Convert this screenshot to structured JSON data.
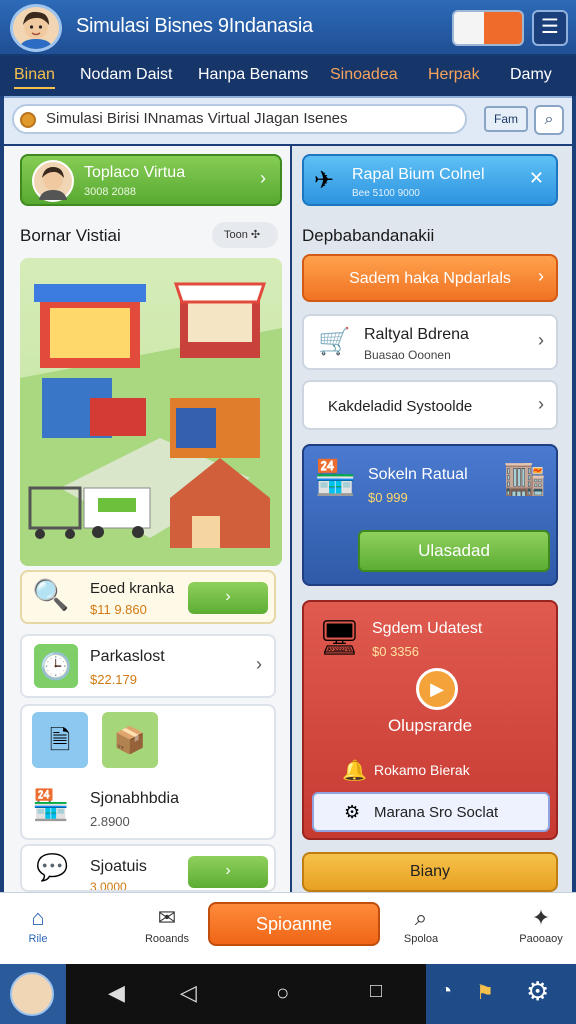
{
  "header": {
    "title": "Simulasi Bisnes 9Indanasia"
  },
  "nav": {
    "tabs": [
      "Binan",
      "Nodam Daist",
      "Hanpa Benams",
      "Sinoadea",
      "Herpak",
      "Damy"
    ]
  },
  "search": {
    "value": "Simulasi Birisi INnamas Virtual JIagan Isenes",
    "chip": "Fam"
  },
  "left": {
    "top_button": {
      "title": "Toplaco Virtua",
      "sub": "3008 2088"
    },
    "section_title": "Bornar Vistiai",
    "section_chip": "Toon",
    "list": [
      {
        "title": "Eoed kranka",
        "value": "$11 9.860"
      },
      {
        "title": "Parkaslost",
        "value": "$22.179"
      },
      {
        "title": "Sjonabhbdia",
        "value": "2.8900"
      },
      {
        "title": "Sjoatuis",
        "value": "3.0000"
      }
    ]
  },
  "right": {
    "top_button": {
      "title": "Rapal Bium Colnel",
      "sub": "Bee 5100 9000"
    },
    "section_title": "Depbabandanakii",
    "orange_button": "Sadem haka Npdarlals",
    "item1": {
      "title": "Raltyal Bdrena",
      "sub": "Buasao Ooonen"
    },
    "item2": {
      "title": "Kakdeladid Systoolde"
    },
    "blue_card": {
      "title": "Sokeln Ratual",
      "value": "$0 999",
      "button": "Ulasadad"
    },
    "red_card": {
      "title": "Sgdem Udatest",
      "value": "$0 3356",
      "action": "Olupsrarde",
      "note": "Rokamo Bierak",
      "button": "Marana Sro Soclat"
    },
    "yellow_button": "Biany"
  },
  "bottom": {
    "items": [
      {
        "label": "Rile",
        "icon": "home-icon"
      },
      {
        "label": "Rooands",
        "icon": "mail-icon"
      },
      {
        "label": "Spoloa",
        "icon": "search-icon"
      },
      {
        "label": "Paooaoy",
        "icon": "puzzle-icon"
      }
    ],
    "center": "Spioanne"
  },
  "colors": {
    "accent": "#f6c04c",
    "header": "#1f4f94",
    "green": "#6bc13c",
    "orange": "#f06617",
    "red": "#d7453d",
    "blue": "#3a62b0"
  }
}
